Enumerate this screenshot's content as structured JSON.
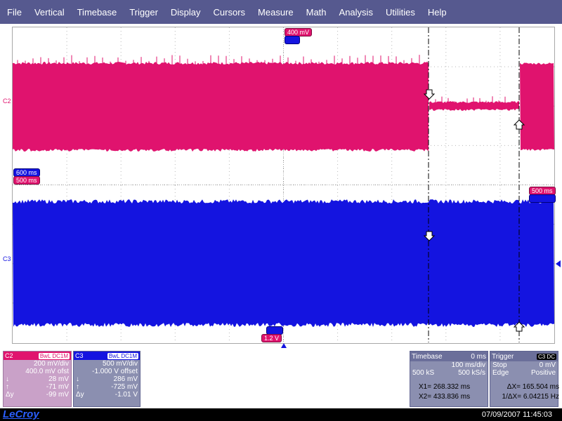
{
  "menu": [
    "File",
    "Vertical",
    "Timebase",
    "Trigger",
    "Display",
    "Cursors",
    "Measure",
    "Math",
    "Analysis",
    "Utilities",
    "Help"
  ],
  "scope": {
    "c2_label": "C2",
    "c3_label": "C3",
    "tags": {
      "c2_top": "400 mV",
      "left_blue": "600 ms",
      "left_pink": "500 ms",
      "right_pink": "500 ms",
      "bottom_pink": "1.2 V"
    },
    "colors": {
      "c2": "#e0136e",
      "c3": "#1414e0",
      "grid": "#b8b8b8"
    }
  },
  "c2_panel": {
    "title": "C2",
    "badge": "BwL DC1M",
    "rows": [
      {
        "l": "",
        "r": "200 mV/div"
      },
      {
        "l": "",
        "r": "400.0 mV ofst"
      },
      {
        "l": "↓",
        "r": "28 mV"
      },
      {
        "l": "↑",
        "r": "-71 mV"
      },
      {
        "l": "Δy",
        "r": "-99 mV"
      }
    ]
  },
  "c3_panel": {
    "title": "C3",
    "badge": "BwL DC1M",
    "rows": [
      {
        "l": "",
        "r": "500 mV/div"
      },
      {
        "l": "",
        "r": "-1.000 V offset"
      },
      {
        "l": "↓",
        "r": "286 mV"
      },
      {
        "l": "↑",
        "r": "-725 mV"
      },
      {
        "l": "Δy",
        "r": "-1.01 V"
      }
    ]
  },
  "timebase": {
    "title": "Timebase",
    "value": "0 ms",
    "rows": [
      {
        "l": "",
        "r": "100 ms/div"
      },
      {
        "l": "500 kS",
        "r": "500 kS/s"
      }
    ]
  },
  "trigger": {
    "title": "Trigger",
    "badge": "C3 DC",
    "rows": [
      {
        "l": "Stop",
        "r": "0 mV"
      },
      {
        "l": "Edge",
        "r": "Positive"
      }
    ]
  },
  "cursors": {
    "x1": "X1= 268.332 ms",
    "dx": "ΔX= 165.504 ms",
    "x2": "X2= 433.836 ms",
    "freq": "1/ΔX= 6.04215 Hz"
  },
  "status": {
    "logo": "LeCroy",
    "datetime": "07/09/2007 11:45:03"
  }
}
